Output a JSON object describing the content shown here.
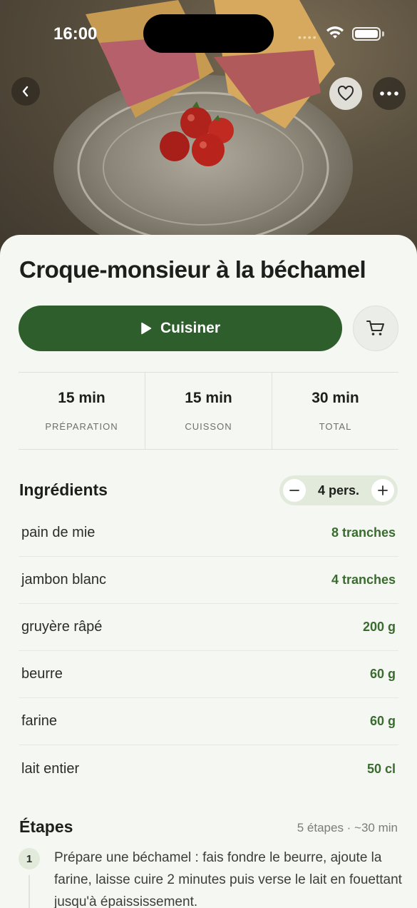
{
  "status_bar": {
    "time": "16:00",
    "dots": "••••"
  },
  "hero": {
    "image": "croque-monsieur-photo",
    "actions": [
      "back-icon",
      "heart-icon",
      "more-icon"
    ]
  },
  "recipe": {
    "title": "Croque-monsieur à la béchamel"
  },
  "actions": {
    "cook_label": "Cuisiner",
    "cart_icon": "cart-icon"
  },
  "times": [
    {
      "value": "15 min",
      "label": "PRÉPARATION"
    },
    {
      "value": "15 min",
      "label": "CUISSON"
    },
    {
      "value": "30 min",
      "label": "TOTAL"
    }
  ],
  "ingredients": {
    "title": "Ingrédients",
    "servings": "4 pers.",
    "items": [
      {
        "name": "pain de mie",
        "qty": "8 tranches"
      },
      {
        "name": "jambon blanc",
        "qty": "4 tranches"
      },
      {
        "name": "gruyère râpé",
        "qty": "200 g"
      },
      {
        "name": "beurre",
        "qty": "60 g"
      },
      {
        "name": "farine",
        "qty": "60 g"
      },
      {
        "name": "lait entier",
        "qty": "50 cl"
      }
    ]
  },
  "steps": {
    "title": "Étapes",
    "meta": "5 étapes · ~30 min",
    "items": [
      {
        "num": "1",
        "text": "Prépare une béchamel : fais fondre le beurre, ajoute la farine, laisse cuire 2 minutes puis verse le lait en fouettant jusqu'à épaississement."
      }
    ]
  },
  "colors": {
    "accent": "#2e5e2b",
    "qty": "#3a6b2f",
    "background": "#f4f7f2"
  }
}
